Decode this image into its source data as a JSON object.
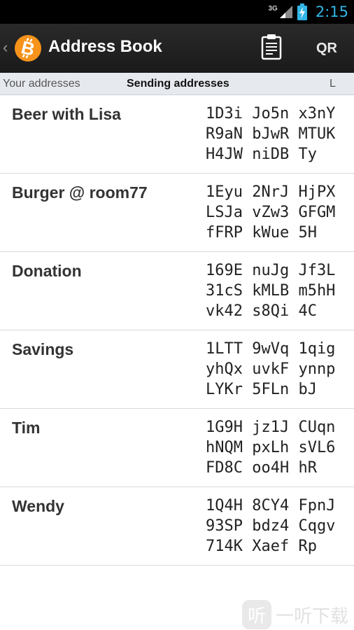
{
  "status_bar": {
    "network_type": "3G",
    "time": "2:15"
  },
  "action_bar": {
    "up_caret": "‹",
    "title": "Address Book",
    "qr_label": "QR"
  },
  "tabs": {
    "left": "Your addresses",
    "center": "Sending addresses",
    "right": "L"
  },
  "contacts": [
    {
      "label": "Beer with Lisa",
      "address_lines": [
        "1D3i Jo5n x3nY",
        "R9aN bJwR MTUK",
        "H4JW niDB Ty"
      ]
    },
    {
      "label": "Burger @ room77",
      "address_lines": [
        "1Eyu 2NrJ HjPX",
        "LSJa vZw3 GFGM",
        "fFRP kWue 5H"
      ]
    },
    {
      "label": "Donation",
      "address_lines": [
        "169E nuJg Jf3L",
        "31cS kMLB m5hH",
        "vk42 s8Qi 4C"
      ]
    },
    {
      "label": "Savings",
      "address_lines": [
        "1LTT 9wVq 1qig",
        "yhQx uvkF ynnp",
        "LYKr 5FLn bJ"
      ]
    },
    {
      "label": "Tim",
      "address_lines": [
        "1G9H jz1J CUqn",
        "hNQM pxLh sVL6",
        "FD8C oo4H hR"
      ]
    },
    {
      "label": "Wendy",
      "address_lines": [
        "1Q4H 8CY4 FpnJ",
        "93SP bdz4 Cqgv",
        "714K Xaef Rp"
      ]
    }
  ],
  "watermark": {
    "logo_glyph": "听",
    "text": "一听下载"
  },
  "colors": {
    "status_bar_bg": "#000000",
    "clock": "#33b5e5",
    "action_bar_bg": "#1f1f1f",
    "bitcoin_orange": "#f7931a",
    "tab_strip_bg": "#e6e9ee",
    "divider": "#d8d8d8"
  },
  "icons": {
    "signal": "signal-icon",
    "battery": "battery-charging-icon",
    "app_logo": "bitcoin-logo-icon",
    "clipboard": "clipboard-icon"
  }
}
